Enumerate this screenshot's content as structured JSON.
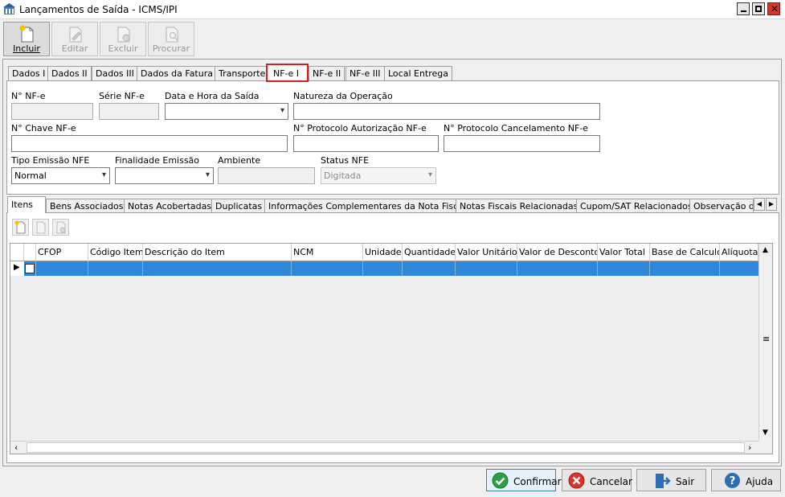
{
  "window": {
    "title": "Lançamentos de Saída - ICMS/IPI"
  },
  "toolbar": [
    {
      "label": "Incluir",
      "icon": "new-document-icon",
      "enabled": true
    },
    {
      "label": "Editar",
      "icon": "edit-document-icon",
      "enabled": false
    },
    {
      "label": "Excluir",
      "icon": "delete-document-icon",
      "enabled": false
    },
    {
      "label": "Procurar",
      "icon": "search-document-icon",
      "enabled": false
    }
  ],
  "tabs": [
    "Dados I",
    "Dados II",
    "Dados III",
    "Dados da Fatura",
    "Transporte",
    "NF-e I",
    "NF-e II",
    "NF-e III",
    "Local Entrega"
  ],
  "selected_tab": "NF-e I",
  "form": {
    "nf_numero_label": "N° NF-e",
    "serie_label": "Série NF-e",
    "data_saida_label": "Data e Hora da Saída",
    "natureza_label": "Natureza da Operação",
    "chave_label": "N° Chave NF-e",
    "protocolo_aut_label": "N° Protocolo Autorização NF-e",
    "protocolo_canc_label": "N° Protocolo Cancelamento NF-e",
    "tipo_emissao_label": "Tipo Emissão NFE",
    "tipo_emissao_value": "Normal",
    "finalidade_label": "Finalidade Emissão",
    "ambiente_label": "Ambiente",
    "status_label": "Status NFE",
    "status_value": "Digitada"
  },
  "lower_tabs": [
    "Itens",
    "Bens Associados",
    "Notas Acobertadas",
    "Duplicatas",
    "Informações Complementares da Nota Fiscal",
    "Notas Fiscais Relacionadas",
    "Cupom/SAT Relacionados",
    "Observação de"
  ],
  "grid": {
    "columns": [
      "CFOP",
      "Código Item",
      "Descrição do Item",
      "NCM",
      "Unidade",
      "Quantidade",
      "Valor Unitário",
      "Valor de Desconto",
      "Valor Total",
      "Base de Calculo",
      "Alíquota"
    ]
  },
  "buttons": {
    "confirmar": "Confirmar",
    "cancelar": "Cancelar",
    "sair": "Sair",
    "ajuda": "Ajuda"
  },
  "colors": {
    "selection": "#2f87d9",
    "tab_highlight": "#d81e1e"
  }
}
